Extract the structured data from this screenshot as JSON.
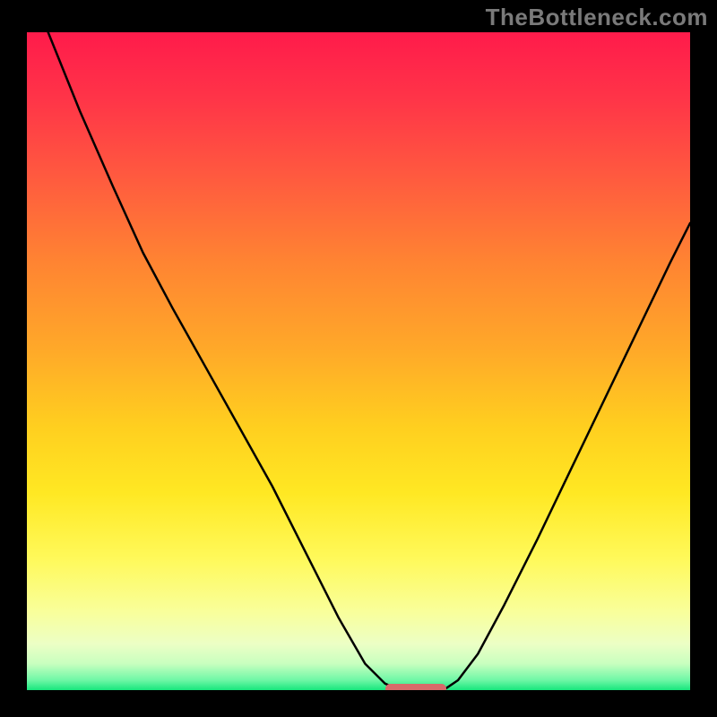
{
  "watermark": "TheBottleneck.com",
  "gradient_stops": [
    {
      "offset": "0%",
      "color": "#ff1b4b"
    },
    {
      "offset": "10%",
      "color": "#ff3448"
    },
    {
      "offset": "22%",
      "color": "#ff5a3f"
    },
    {
      "offset": "35%",
      "color": "#ff8432"
    },
    {
      "offset": "48%",
      "color": "#ffa829"
    },
    {
      "offset": "60%",
      "color": "#ffcf1f"
    },
    {
      "offset": "70%",
      "color": "#ffe823"
    },
    {
      "offset": "80%",
      "color": "#fff95a"
    },
    {
      "offset": "88%",
      "color": "#f9ff9a"
    },
    {
      "offset": "93%",
      "color": "#ecffc5"
    },
    {
      "offset": "96%",
      "color": "#c8ffbf"
    },
    {
      "offset": "98.5%",
      "color": "#6ef7a6"
    },
    {
      "offset": "100%",
      "color": "#17e67c"
    }
  ],
  "curve": {
    "stroke": "#000000",
    "stroke_width": 2.5,
    "left_points": [
      {
        "x": 0.032,
        "y": 0.0
      },
      {
        "x": 0.08,
        "y": 0.12
      },
      {
        "x": 0.13,
        "y": 0.235
      },
      {
        "x": 0.175,
        "y": 0.335
      },
      {
        "x": 0.22,
        "y": 0.42
      },
      {
        "x": 0.27,
        "y": 0.51
      },
      {
        "x": 0.32,
        "y": 0.6
      },
      {
        "x": 0.37,
        "y": 0.69
      },
      {
        "x": 0.42,
        "y": 0.79
      },
      {
        "x": 0.47,
        "y": 0.89
      },
      {
        "x": 0.51,
        "y": 0.96
      },
      {
        "x": 0.54,
        "y": 0.99
      },
      {
        "x": 0.562,
        "y": 1.0
      }
    ],
    "right_points": [
      {
        "x": 0.628,
        "y": 1.0
      },
      {
        "x": 0.65,
        "y": 0.985
      },
      {
        "x": 0.68,
        "y": 0.945
      },
      {
        "x": 0.72,
        "y": 0.87
      },
      {
        "x": 0.77,
        "y": 0.77
      },
      {
        "x": 0.82,
        "y": 0.665
      },
      {
        "x": 0.87,
        "y": 0.56
      },
      {
        "x": 0.92,
        "y": 0.455
      },
      {
        "x": 0.97,
        "y": 0.35
      },
      {
        "x": 1.0,
        "y": 0.29
      }
    ]
  },
  "marker": {
    "left_frac": 0.54,
    "right_frac": 0.632,
    "color": "#d86a6a"
  },
  "chart_data": {
    "type": "line",
    "title": "",
    "xlabel": "",
    "ylabel": "",
    "note": "Axes unlabeled in image; x and y use 0–1 normalized plot-area coordinates (y=0 top, y=1 bottom). Two curve branches meet near the bottom where a marker sits.",
    "series": [
      {
        "name": "left-branch",
        "points": [
          {
            "x": 0.032,
            "y": 0.0
          },
          {
            "x": 0.08,
            "y": 0.12
          },
          {
            "x": 0.13,
            "y": 0.235
          },
          {
            "x": 0.175,
            "y": 0.335
          },
          {
            "x": 0.22,
            "y": 0.42
          },
          {
            "x": 0.27,
            "y": 0.51
          },
          {
            "x": 0.32,
            "y": 0.6
          },
          {
            "x": 0.37,
            "y": 0.69
          },
          {
            "x": 0.42,
            "y": 0.79
          },
          {
            "x": 0.47,
            "y": 0.89
          },
          {
            "x": 0.51,
            "y": 0.96
          },
          {
            "x": 0.54,
            "y": 0.99
          },
          {
            "x": 0.562,
            "y": 1.0
          }
        ]
      },
      {
        "name": "right-branch",
        "points": [
          {
            "x": 0.628,
            "y": 1.0
          },
          {
            "x": 0.65,
            "y": 0.985
          },
          {
            "x": 0.68,
            "y": 0.945
          },
          {
            "x": 0.72,
            "y": 0.87
          },
          {
            "x": 0.77,
            "y": 0.77
          },
          {
            "x": 0.82,
            "y": 0.665
          },
          {
            "x": 0.87,
            "y": 0.56
          },
          {
            "x": 0.92,
            "y": 0.455
          },
          {
            "x": 0.97,
            "y": 0.35
          },
          {
            "x": 1.0,
            "y": 0.29
          }
        ]
      }
    ],
    "marker_region": {
      "x_start": 0.54,
      "x_end": 0.632,
      "y": 1.0
    },
    "xlim": [
      0,
      1
    ],
    "ylim": [
      0,
      1
    ]
  }
}
